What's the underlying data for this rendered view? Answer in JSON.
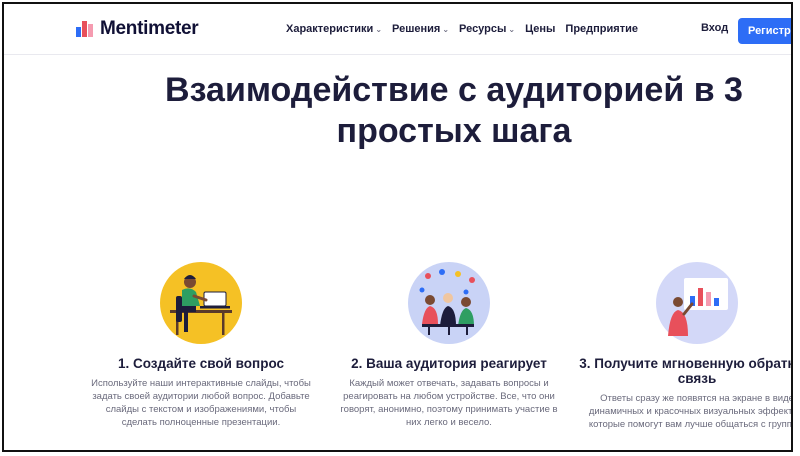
{
  "brand": {
    "name": "Mentimeter",
    "colors": [
      "#e8505b",
      "#2d6df6",
      "#101035"
    ]
  },
  "nav": {
    "items": [
      {
        "label": "Характеристики",
        "has_dropdown": true
      },
      {
        "label": "Решения",
        "has_dropdown": true
      },
      {
        "label": "Ресурсы",
        "has_dropdown": true
      },
      {
        "label": "Цены",
        "has_dropdown": false
      },
      {
        "label": "Предприятие",
        "has_dropdown": false
      }
    ],
    "login_label": "Вход",
    "signup_label": "Регистрация"
  },
  "hero": {
    "title": "Взаимодействие с аудиторией в 3 простых шага"
  },
  "steps": [
    {
      "title": "1. Создайте свой вопрос",
      "description": "Используйте наши интерактивные слайды, чтобы задать своей аудитории любой вопрос. Добавьте слайды с текстом и изображениями, чтобы сделать полноценные презентации.",
      "icon": "person-at-laptop-illustration",
      "bg_color": "#f5c125"
    },
    {
      "title": "2. Ваша аудитория реагирует",
      "description": "Каждый может отвечать, задавать вопросы и реагировать на любом устройстве. Все, что они говорят, анонимно, поэтому принимать участие в них легко и весело.",
      "icon": "audience-group-illustration",
      "bg_color": "#c9d3f6"
    },
    {
      "title": "3. Получите мгновенную обратную связь",
      "description": "Ответы сразу же появятся на экране в виде динамичных и красочных визуальных эффектов, которые помогут вам лучше общаться с группой.",
      "icon": "presenter-chart-illustration",
      "bg_color": "#d3d8f8"
    }
  ]
}
